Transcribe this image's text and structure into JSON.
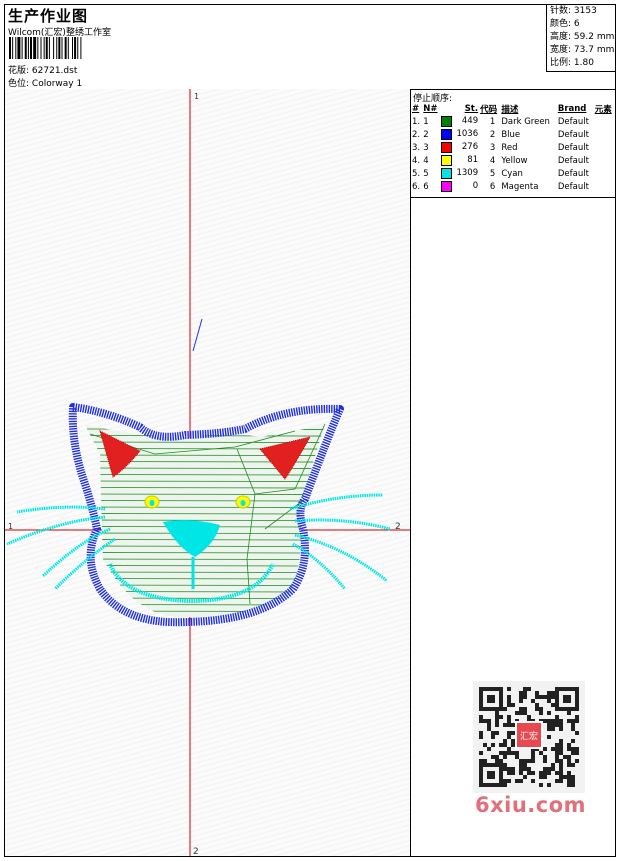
{
  "header": {
    "title": "生产作业图",
    "company": "Wilcom(汇宏)整绣工作室",
    "design_label": "花版:",
    "design_value": "62721.dst",
    "colorway_label": "色位:",
    "colorway_value": "Colorway 1"
  },
  "stats": [
    {
      "label": "针数:",
      "value": "3153"
    },
    {
      "label": "颜色:",
      "value": "6"
    },
    {
      "label": "高度:",
      "value": "59.2 mm"
    },
    {
      "label": "宽度:",
      "value": "73.7 mm"
    },
    {
      "label": "比例:",
      "value": "1.80"
    }
  ],
  "stop_sequence": {
    "title": "停止顺序:",
    "headers": [
      "#",
      "N#",
      "St.",
      "代码",
      "描述",
      "Brand",
      "元素"
    ],
    "rows": [
      {
        "num": "1.",
        "n": "1",
        "color": "#008000",
        "st": "449",
        "code": "1",
        "desc": "Dark Green",
        "brand": "Default"
      },
      {
        "num": "2.",
        "n": "2",
        "color": "#0000ff",
        "st": "1036",
        "code": "2",
        "desc": "Blue",
        "brand": "Default"
      },
      {
        "num": "3.",
        "n": "3",
        "color": "#ff0000",
        "st": "276",
        "code": "3",
        "desc": "Red",
        "brand": "Default"
      },
      {
        "num": "4.",
        "n": "4",
        "color": "#ffff00",
        "st": "81",
        "code": "4",
        "desc": "Yellow",
        "brand": "Default"
      },
      {
        "num": "5.",
        "n": "5",
        "color": "#00e5e5",
        "st": "1309",
        "code": "5",
        "desc": "Cyan",
        "brand": "Default"
      },
      {
        "num": "6.",
        "n": "6",
        "color": "#ff00ff",
        "st": "0",
        "code": "6",
        "desc": "Magenta",
        "brand": "Default"
      }
    ]
  },
  "canvas": {
    "axis_labels": {
      "top": "1",
      "bottom": "2",
      "left": "1",
      "right": "2"
    },
    "crosshair_color": "#cc0000"
  },
  "watermark": {
    "text": "6xiu.com",
    "qr_center_text": "汇宏"
  }
}
